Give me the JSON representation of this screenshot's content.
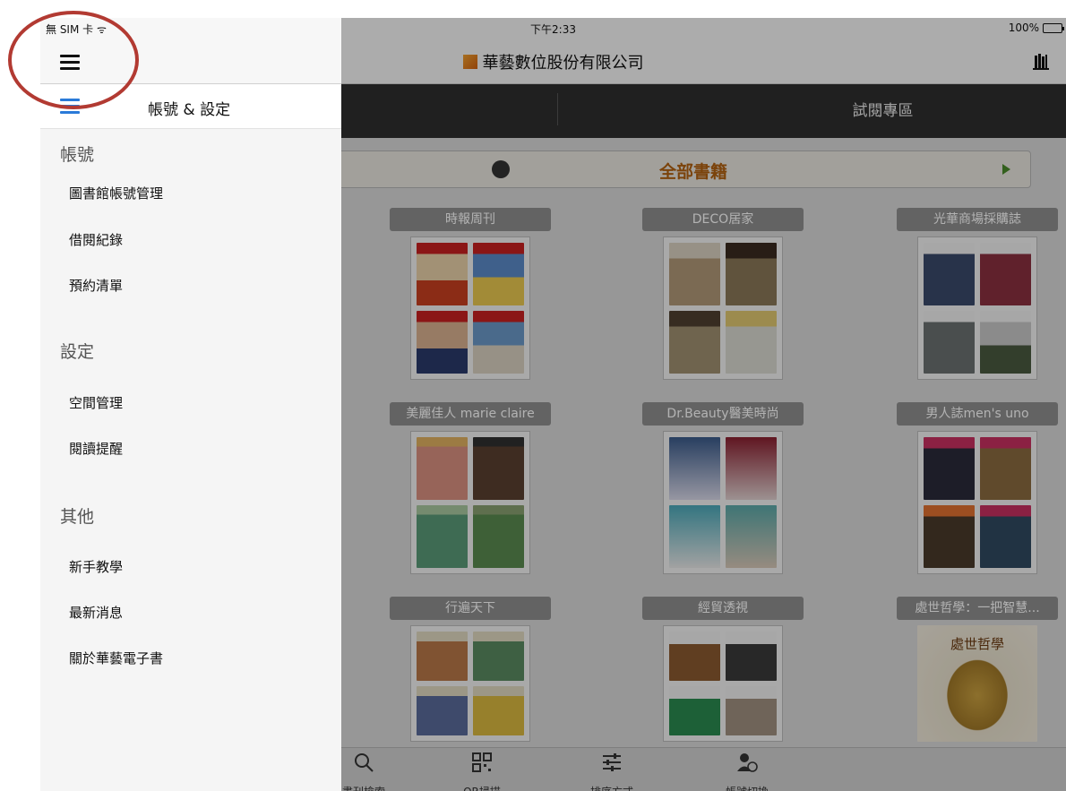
{
  "status_bar": {
    "carrier": "無 SIM 卡 ᯤ",
    "time": "下午2:33",
    "battery": "100%",
    "battery_level": 1.0
  },
  "nav": {
    "title": "華藝數位股份有限公司",
    "menu_icon": "hamburger-icon",
    "right_icon": "bookshelf-icon"
  },
  "tabs": {
    "trial": "試閱專區"
  },
  "category": {
    "label": "全部書籍"
  },
  "magazines": [
    {
      "title": "時報周刊"
    },
    {
      "title": "DECO居家"
    },
    {
      "title": "光華商場採購誌"
    },
    {
      "title": "美麗佳人 marie claire"
    },
    {
      "title": "Dr.Beauty醫美時尚"
    },
    {
      "title": "男人誌men's uno"
    },
    {
      "title": "行遍天下"
    },
    {
      "title": "經貿透視"
    },
    {
      "title": "處世哲學：一把智慧...",
      "cover_text": "處世哲學"
    }
  ],
  "toolbar": [
    {
      "label": "書刊檢索",
      "icon": "search-icon"
    },
    {
      "label": "QR掃描",
      "icon": "qr-code-icon"
    },
    {
      "label": "排序方式",
      "icon": "sliders-icon"
    },
    {
      "label": "帳號切換",
      "icon": "user-switch-icon"
    }
  ],
  "drawer": {
    "title": "帳號 & 設定",
    "sections": [
      {
        "title": "帳號",
        "items": [
          "圖書館帳號管理",
          "借閱紀錄",
          "預約清單"
        ]
      },
      {
        "title": "設定",
        "items": [
          "空間管理",
          "閱讀提醒"
        ]
      },
      {
        "title": "其他",
        "items": [
          "新手教學",
          "最新消息",
          "關於華藝電子書"
        ]
      }
    ]
  },
  "colors": {
    "accent_blue": "#2a7ad8",
    "category_orange": "#b06010",
    "highlight_red": "#b23a32"
  }
}
